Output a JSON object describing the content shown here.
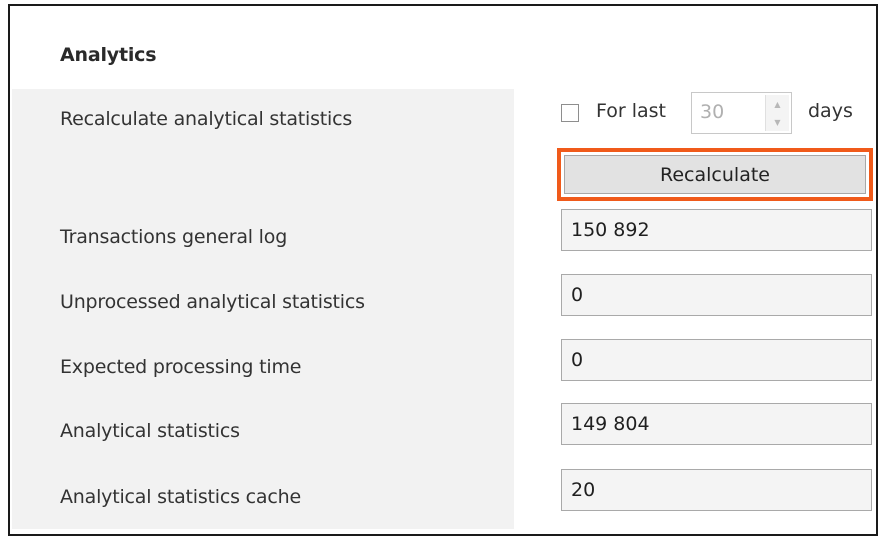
{
  "section": {
    "title": "Analytics"
  },
  "recalculate": {
    "label": "Recalculate analytical statistics",
    "checkbox_label": "For last",
    "checkbox_checked": false,
    "days_value": "30",
    "days_unit": "days",
    "button_label": "Recalculate",
    "highlight_color": "#f05a1a"
  },
  "fields": [
    {
      "label": "Transactions general log",
      "value": "150 892"
    },
    {
      "label": "Unprocessed analytical statistics",
      "value": "0"
    },
    {
      "label": "Expected processing time",
      "value": "0"
    },
    {
      "label": "Analytical statistics",
      "value": "149 804"
    },
    {
      "label": "Analytical statistics cache",
      "value": "20"
    }
  ]
}
